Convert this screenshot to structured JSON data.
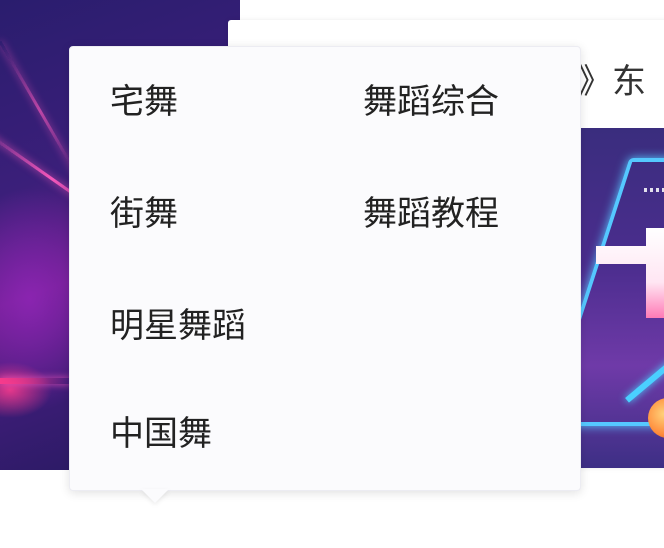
{
  "background_card": {
    "title_fragment": "》东"
  },
  "category_menu": {
    "items": [
      {
        "label": "宅舞"
      },
      {
        "label": "舞蹈综合"
      },
      {
        "label": "街舞"
      },
      {
        "label": "舞蹈教程"
      },
      {
        "label": "明星舞蹈"
      },
      {
        "label": "中国舞"
      }
    ]
  },
  "colors": {
    "popup_bg": "#fbfbfd",
    "menu_text": "#222222",
    "banner_purple": "#3b1f7a",
    "neon_pink": "#ff5abe",
    "neon_blue": "#55c8ff"
  }
}
